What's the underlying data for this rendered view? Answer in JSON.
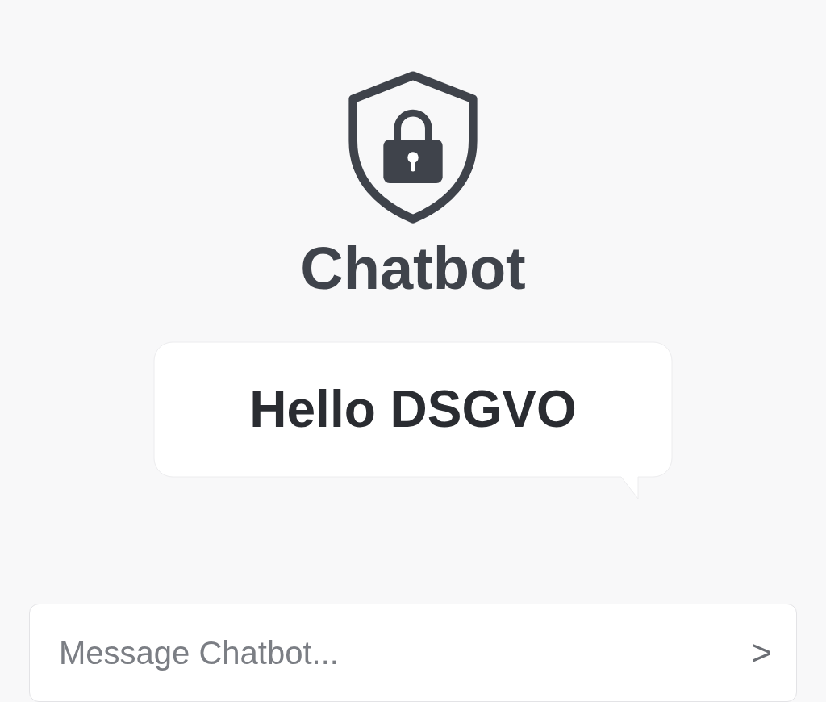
{
  "app": {
    "title": "Chatbot"
  },
  "message": {
    "text": "Hello DSGVO"
  },
  "composer": {
    "placeholder": "Message Chatbot...",
    "send": ">"
  }
}
